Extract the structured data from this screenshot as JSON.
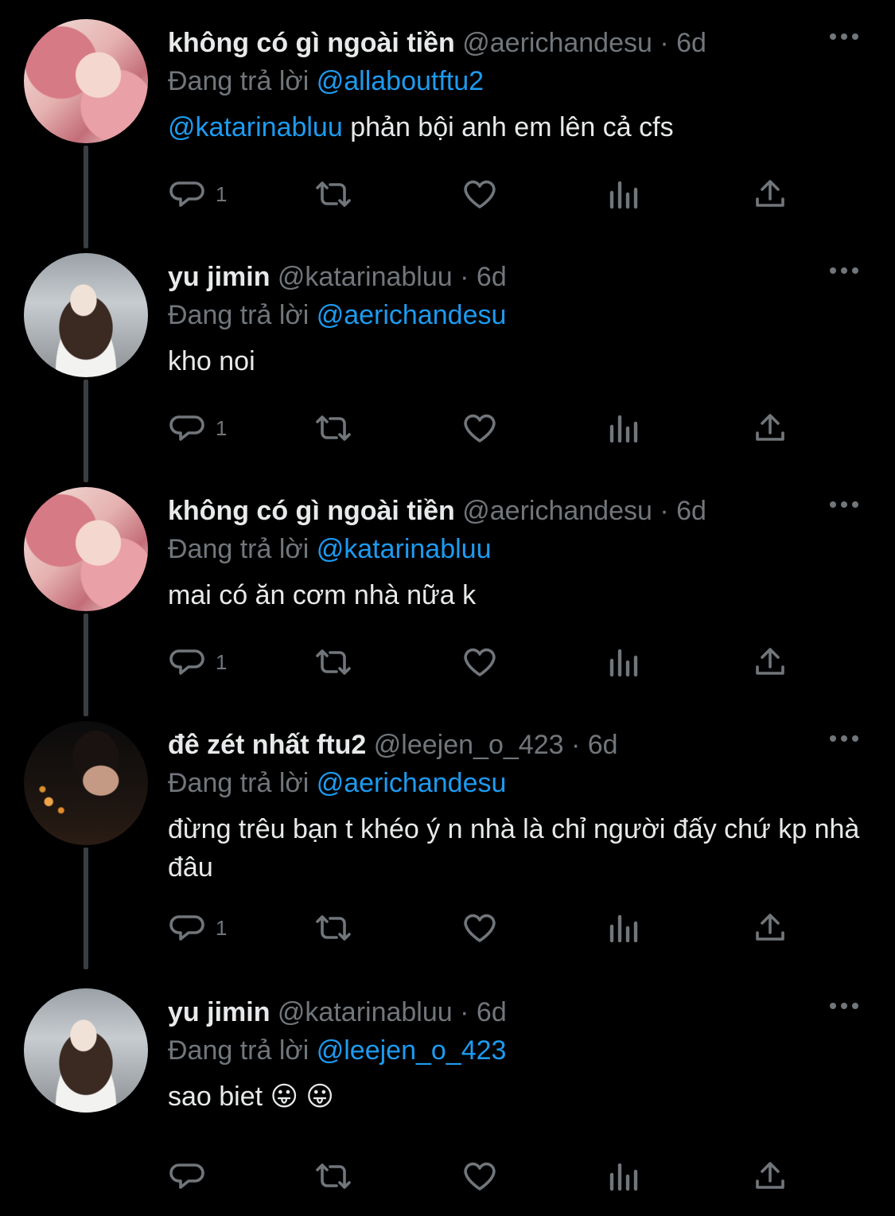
{
  "tweets": [
    {
      "avatar_icon": "avatar-pink-hair",
      "name": "không có gì ngoài tiền",
      "handle": "@aerichandesu",
      "time": "· 6d",
      "reply_prefix": "Đang trả lời",
      "reply_to": "@allaboutftu2",
      "mention": "@katarinabluu",
      "text": " phản bội anh em lên cả cfs",
      "reply_count": "1"
    },
    {
      "avatar_icon": "avatar-yu-jimin",
      "name": "yu jimin",
      "handle": "@katarinabluu",
      "time": "· 6d",
      "reply_prefix": "Đang trả lời",
      "reply_to": "@aerichandesu",
      "text": "kho noi",
      "reply_count": "1"
    },
    {
      "avatar_icon": "avatar-pink-hair",
      "name": "không có gì ngoài tiền",
      "handle": "@aerichandesu",
      "time": "· 6d",
      "reply_prefix": "Đang trả lời",
      "reply_to": "@katarinabluu",
      "text": "mai có ăn cơm nhà nữa k",
      "reply_count": "1"
    },
    {
      "avatar_icon": "avatar-dark-portrait",
      "name": "đê zét nhất ftu2",
      "handle": "@leejen_o_423",
      "time": "· 6d",
      "reply_prefix": "Đang trả lời",
      "reply_to": "@aerichandesu",
      "text": "đừng trêu bạn t khéo ý n nhà là chỉ người đấy chứ kp nhà đâu",
      "reply_count": "1"
    },
    {
      "avatar_icon": "avatar-yu-jimin",
      "name": "yu jimin",
      "handle": "@katarinabluu",
      "time": "· 6d",
      "reply_prefix": "Đang trả lời",
      "reply_to": "@leejen_o_423",
      "text": "sao biet 😛 😛",
      "reply_count": ""
    }
  ],
  "colors": {
    "background": "#000000",
    "text": "#e7e9ea",
    "muted": "#71767b",
    "link": "#1d9bf0",
    "thread_line": "#3a3e42"
  },
  "icons": [
    "reply-icon",
    "retweet-icon",
    "like-icon",
    "stats-icon",
    "share-icon",
    "more-icon"
  ]
}
